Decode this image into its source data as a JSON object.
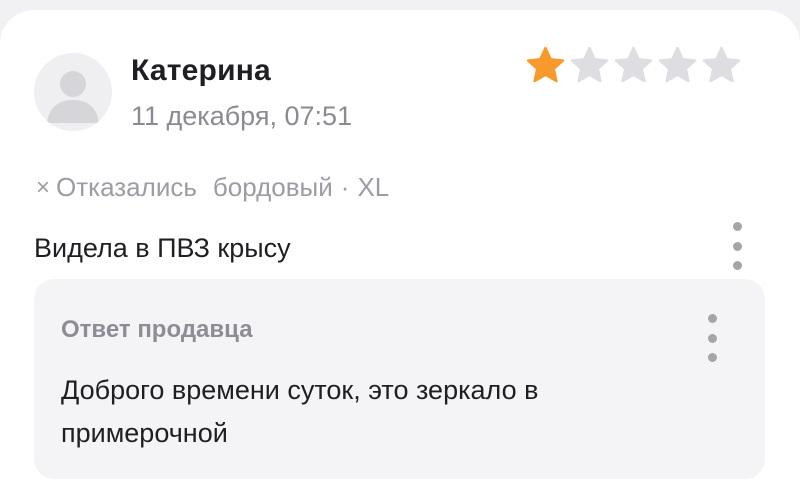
{
  "review": {
    "author": "Катерина",
    "date": "11 декабря, 07:51",
    "rating": 1,
    "rating_max": 5,
    "status_prefix": "×",
    "status": "Отказались",
    "color": "бордовый",
    "separator": "·",
    "size": "XL",
    "text": "Видела в ПВЗ крысу"
  },
  "reply": {
    "title": "Ответ продавца",
    "text": "Доброго времени суток, это зеркало в примерочной"
  },
  "colors": {
    "star_filled": "#f79a2b",
    "star_empty": "#dedee2"
  },
  "icons": {
    "avatar": "user-placeholder-icon",
    "star": "star-icon",
    "menu": "kebab-menu-icon"
  }
}
